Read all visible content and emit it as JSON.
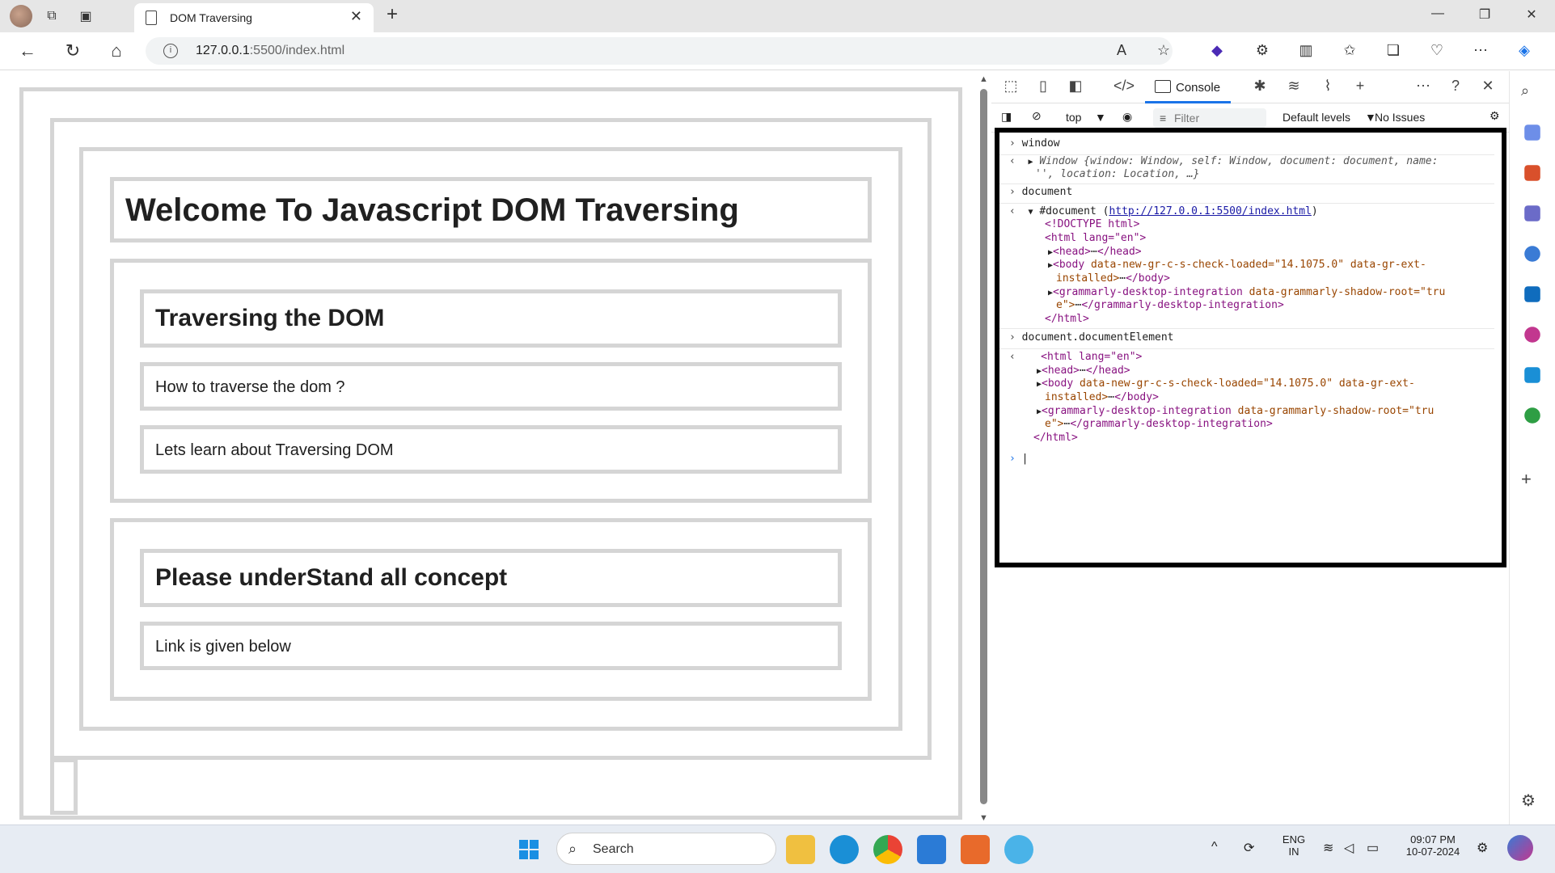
{
  "browser": {
    "tab_title": "DOM Traversing",
    "new_tab": "+",
    "close_tab": "✕",
    "url_host": "127.0.0.1",
    "url_rest": ":5500/index.html",
    "window_controls": {
      "minimize": "—",
      "maximize": "❐",
      "close": "✕"
    }
  },
  "page": {
    "heading": "Welcome To Javascript DOM Traversing",
    "section1": {
      "title": "Traversing the DOM",
      "para1": "How to traverse the dom ?",
      "para2": "Lets learn about Traversing DOM"
    },
    "section2": {
      "title": "Please underStand all concept",
      "para1": "Link is given below"
    }
  },
  "devtools": {
    "console_tab": "Console",
    "context": "top",
    "filter_placeholder": "Filter",
    "levels": "Default levels",
    "issues": "No Issues",
    "entries": {
      "in1": "window",
      "out1_a": "Window {",
      "out1_b": "window: Window, self: Window, document: document, name:",
      "out1_c": "'', location: Location, …}",
      "in2": "document",
      "doc_label": "#document (",
      "doc_link": "http://127.0.0.1:5500/index.html",
      "doc_close": ")",
      "doctype": "<!DOCTYPE html>",
      "html_open": "<html lang=\"en\">",
      "head": "<head>",
      "head_close": "</head>",
      "body_open": "<body",
      "body_attr1": "data-new-gr-c-s-check-loaded=\"14.1075.0\"",
      "body_attr2": "data-gr-ext-",
      "body_attr2b": "installed>",
      "body_close": "</body>",
      "gram_open": "<grammarly-desktop-integration",
      "gram_attr": "data-grammarly-shadow-root=\"tru",
      "gram_attr_b": "e\">",
      "gram_close": "</grammarly-desktop-integration>",
      "html_close": "</html>",
      "in3": "document.documentElement",
      "ellipsis": "⋯"
    }
  },
  "taskbar": {
    "search": "Search",
    "lang1": "ENG",
    "lang2": "IN",
    "time": "09:07 PM",
    "date": "10-07-2024"
  }
}
